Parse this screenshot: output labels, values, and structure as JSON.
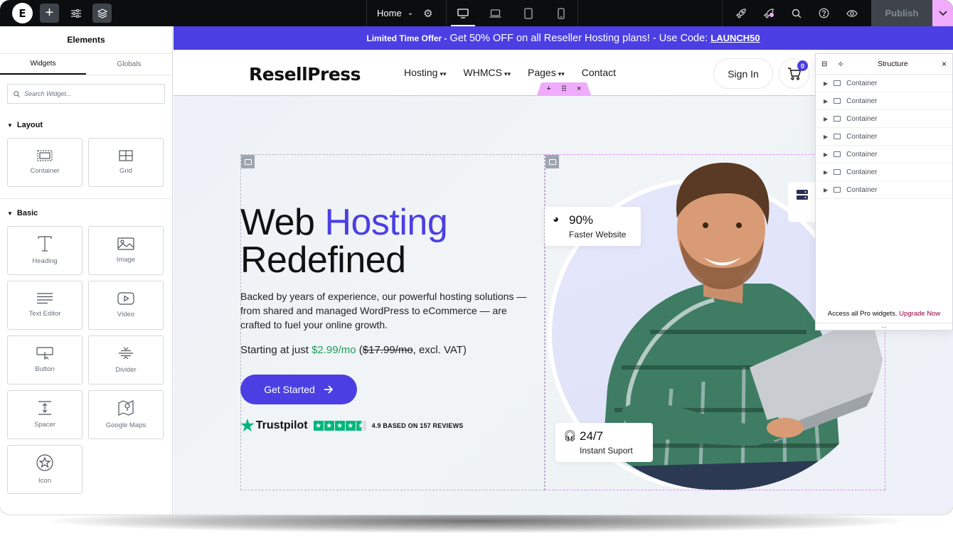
{
  "topbar": {
    "page_name": "Home",
    "publish_label": "Publish"
  },
  "panel": {
    "title": "Elements",
    "tabs": [
      "Widgets",
      "Globals"
    ],
    "search_placeholder": "Search Widget...",
    "sections": [
      {
        "title": "Layout",
        "widgets": [
          {
            "label": "Container",
            "icon": "container-icon"
          },
          {
            "label": "Grid",
            "icon": "grid-icon"
          }
        ]
      },
      {
        "title": "Basic",
        "widgets": [
          {
            "label": "Heading",
            "icon": "heading-icon"
          },
          {
            "label": "Image",
            "icon": "image-icon"
          },
          {
            "label": "Text Editor",
            "icon": "text-editor-icon"
          },
          {
            "label": "Video",
            "icon": "video-icon"
          },
          {
            "label": "Button",
            "icon": "button-icon"
          },
          {
            "label": "Divider",
            "icon": "divider-icon"
          },
          {
            "label": "Spacer",
            "icon": "spacer-icon"
          },
          {
            "label": "Google Maps",
            "icon": "map-icon"
          },
          {
            "label": "Icon",
            "icon": "star-icon"
          }
        ]
      }
    ]
  },
  "site": {
    "promo": {
      "bold": "Limited Time Offer -",
      "text": " Get 50% OFF on all Reseller Hosting plans! - Use Code: ",
      "code": "LAUNCH50"
    },
    "logo": "ResellPress",
    "nav": [
      "Hosting",
      "WHMCS",
      "Pages",
      "Contact"
    ],
    "signin": "Sign In",
    "cart_count": "0",
    "hero": {
      "title_part1": "Web ",
      "title_accent": "Hosting",
      "title_part2": "Redefined",
      "description": "Backed by years of experience, our powerful hosting solutions — from shared and managed WordPress to eCommerce — are crafted to fuel your online growth.",
      "price_prefix": "Starting at just ",
      "price": "$2.99/mo",
      "price_open": " (",
      "price_old": "$17.99/mo",
      "price_suffix": ", excl. VAT)",
      "cta": "Get Started",
      "trustpilot": "Trustpilot",
      "rating_text": "4.9 BASED ON 157 REVIEWS",
      "rating": 4.5,
      "stat1_big": "90%",
      "stat1_small": "Faster Website",
      "stat2_big": "24/7",
      "stat2_small": "Instant Suport"
    }
  },
  "structure": {
    "title": "Structure",
    "items": [
      "Container",
      "Container",
      "Container",
      "Container",
      "Container",
      "Container",
      "Container"
    ],
    "footer_text": "Access all Pro widgets. ",
    "footer_link": "Upgrade Now"
  },
  "colors": {
    "accent": "#4b3fe3",
    "editor_pink": "#f0abfc",
    "price_green": "#1f9e5a",
    "trustpilot_green": "#00b67a"
  }
}
